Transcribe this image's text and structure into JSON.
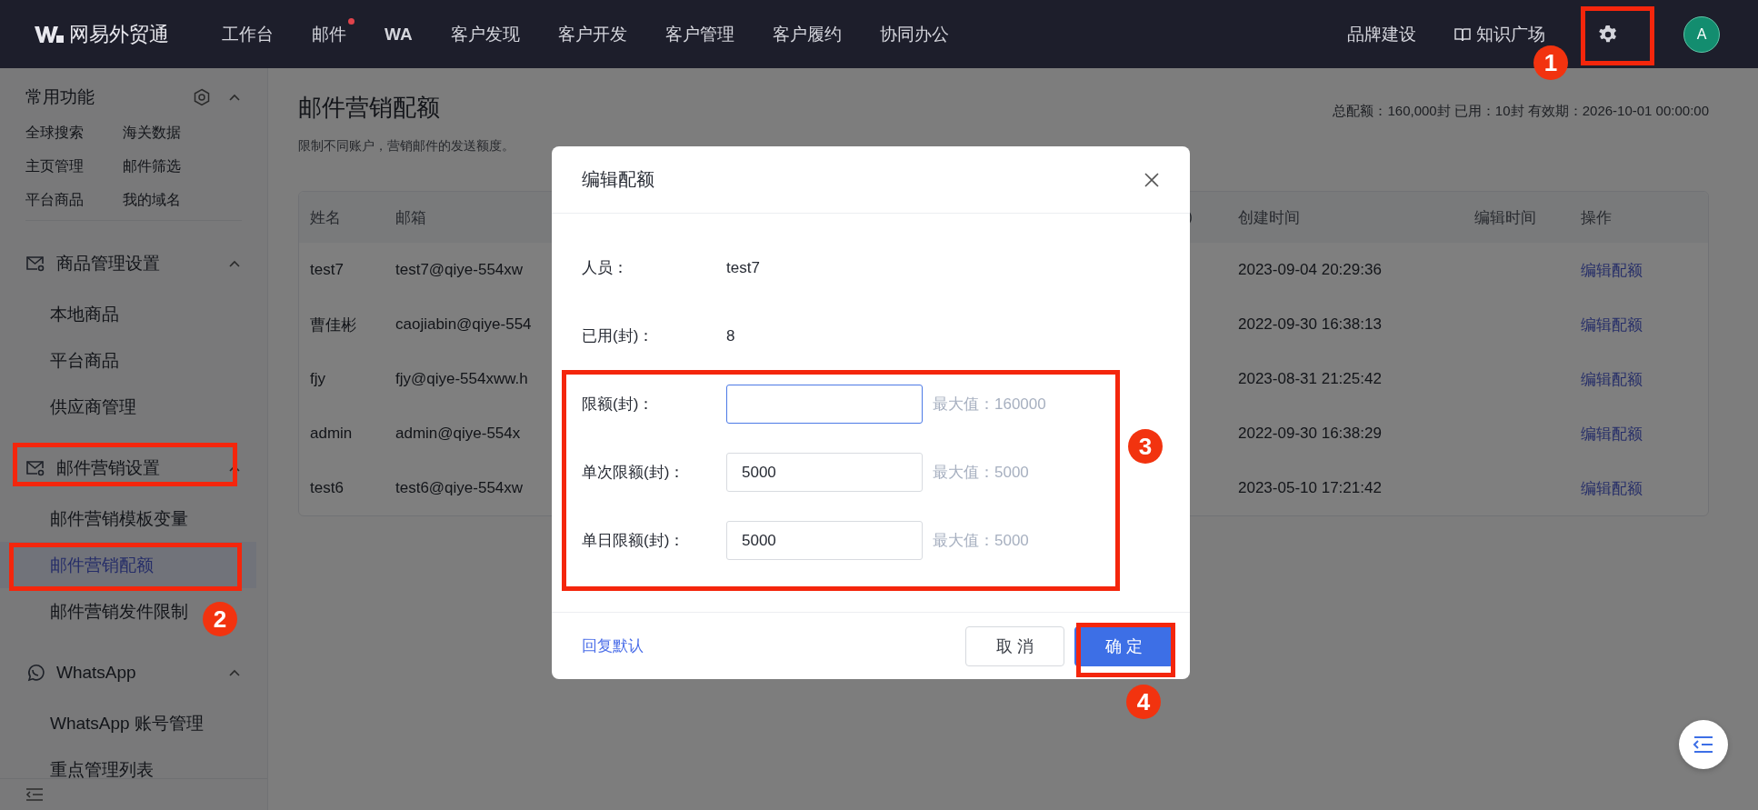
{
  "nav": {
    "logo": "网易外贸通",
    "items": [
      {
        "label": "工作台",
        "dot": false
      },
      {
        "label": "邮件",
        "dot": true
      },
      {
        "label": "WA",
        "dot": false
      },
      {
        "label": "客户发现",
        "dot": false
      },
      {
        "label": "客户开发",
        "dot": false
      },
      {
        "label": "客户管理",
        "dot": false
      },
      {
        "label": "客户履约",
        "dot": false
      },
      {
        "label": "协同办公",
        "dot": false
      }
    ],
    "right_links": [
      {
        "label": "品牌建设"
      },
      {
        "label": "知识广场"
      }
    ],
    "avatar": "A"
  },
  "sidebar": {
    "favorites": {
      "title": "常用功能",
      "expanded": true,
      "items": [
        "全球搜索",
        "海关数据",
        "主页管理",
        "邮件筛选",
        "平台商品",
        "我的域名"
      ]
    },
    "sections": [
      {
        "title": "商品管理设置",
        "expanded": true,
        "items": [
          {
            "label": "本地商品",
            "selected": false
          },
          {
            "label": "平台商品",
            "selected": false
          },
          {
            "label": "供应商管理",
            "selected": false
          }
        ]
      },
      {
        "title": "邮件营销设置",
        "expanded": true,
        "items": [
          {
            "label": "邮件营销模板变量",
            "selected": false
          },
          {
            "label": "邮件营销配额",
            "selected": true
          },
          {
            "label": "邮件营销发件限制",
            "selected": false
          }
        ]
      },
      {
        "title": "WhatsApp",
        "expanded": true,
        "items": [
          {
            "label": "WhatsApp 账号管理",
            "selected": false
          },
          {
            "label": "重点管理列表",
            "selected": false
          }
        ]
      }
    ]
  },
  "page": {
    "title": "邮件营销配额",
    "subtitle": "限制不同账户，营销邮件的发送额度。",
    "summary": "总配额：160,000封 已用：10封 有效期：2026-10-01 00:00:00"
  },
  "table": {
    "columns": [
      "姓名",
      "邮箱",
      ")",
      "创建时间",
      "编辑时间",
      "操作"
    ],
    "rows": [
      {
        "name": "test7",
        "email": "test7@qiye-554xw",
        "created": "2023-09-04 20:29:36",
        "action": "编辑配额"
      },
      {
        "name": "曹佳彬",
        "email": "caojiabin@qiye-554",
        "created": "2022-09-30 16:38:13",
        "action": "编辑配额"
      },
      {
        "name": "fjy",
        "email": "fjy@qiye-554xww.h",
        "created": "2023-08-31 21:25:42",
        "action": "编辑配额"
      },
      {
        "name": "admin",
        "email": "admin@qiye-554x",
        "created": "2022-09-30 16:38:29",
        "action": "编辑配额"
      },
      {
        "name": "test6",
        "email": "test6@qiye-554xw",
        "created": "2023-05-10 17:21:42",
        "action": "编辑配额"
      }
    ]
  },
  "dialog": {
    "title": "编辑配额",
    "fields": [
      {
        "kind": "text",
        "label": "人员：",
        "value": "test7"
      },
      {
        "kind": "text",
        "label": "已用(封)：",
        "value": "8"
      },
      {
        "kind": "input",
        "label": "限额(封)：",
        "focused": true,
        "hint": "最大值：160000"
      },
      {
        "kind": "input",
        "label": "单次限额(封)：",
        "value": "5000",
        "focused": false,
        "hint": "最大值：5000"
      },
      {
        "kind": "input",
        "label": "单日限额(封)：",
        "value": "5000",
        "focused": false,
        "hint": "最大值：5000"
      }
    ],
    "reset": "回复默认",
    "cancel": "取 消",
    "ok": "确 定"
  },
  "annotations": [
    {
      "number": "1"
    },
    {
      "number": "2"
    },
    {
      "number": "3"
    },
    {
      "number": "4"
    }
  ]
}
